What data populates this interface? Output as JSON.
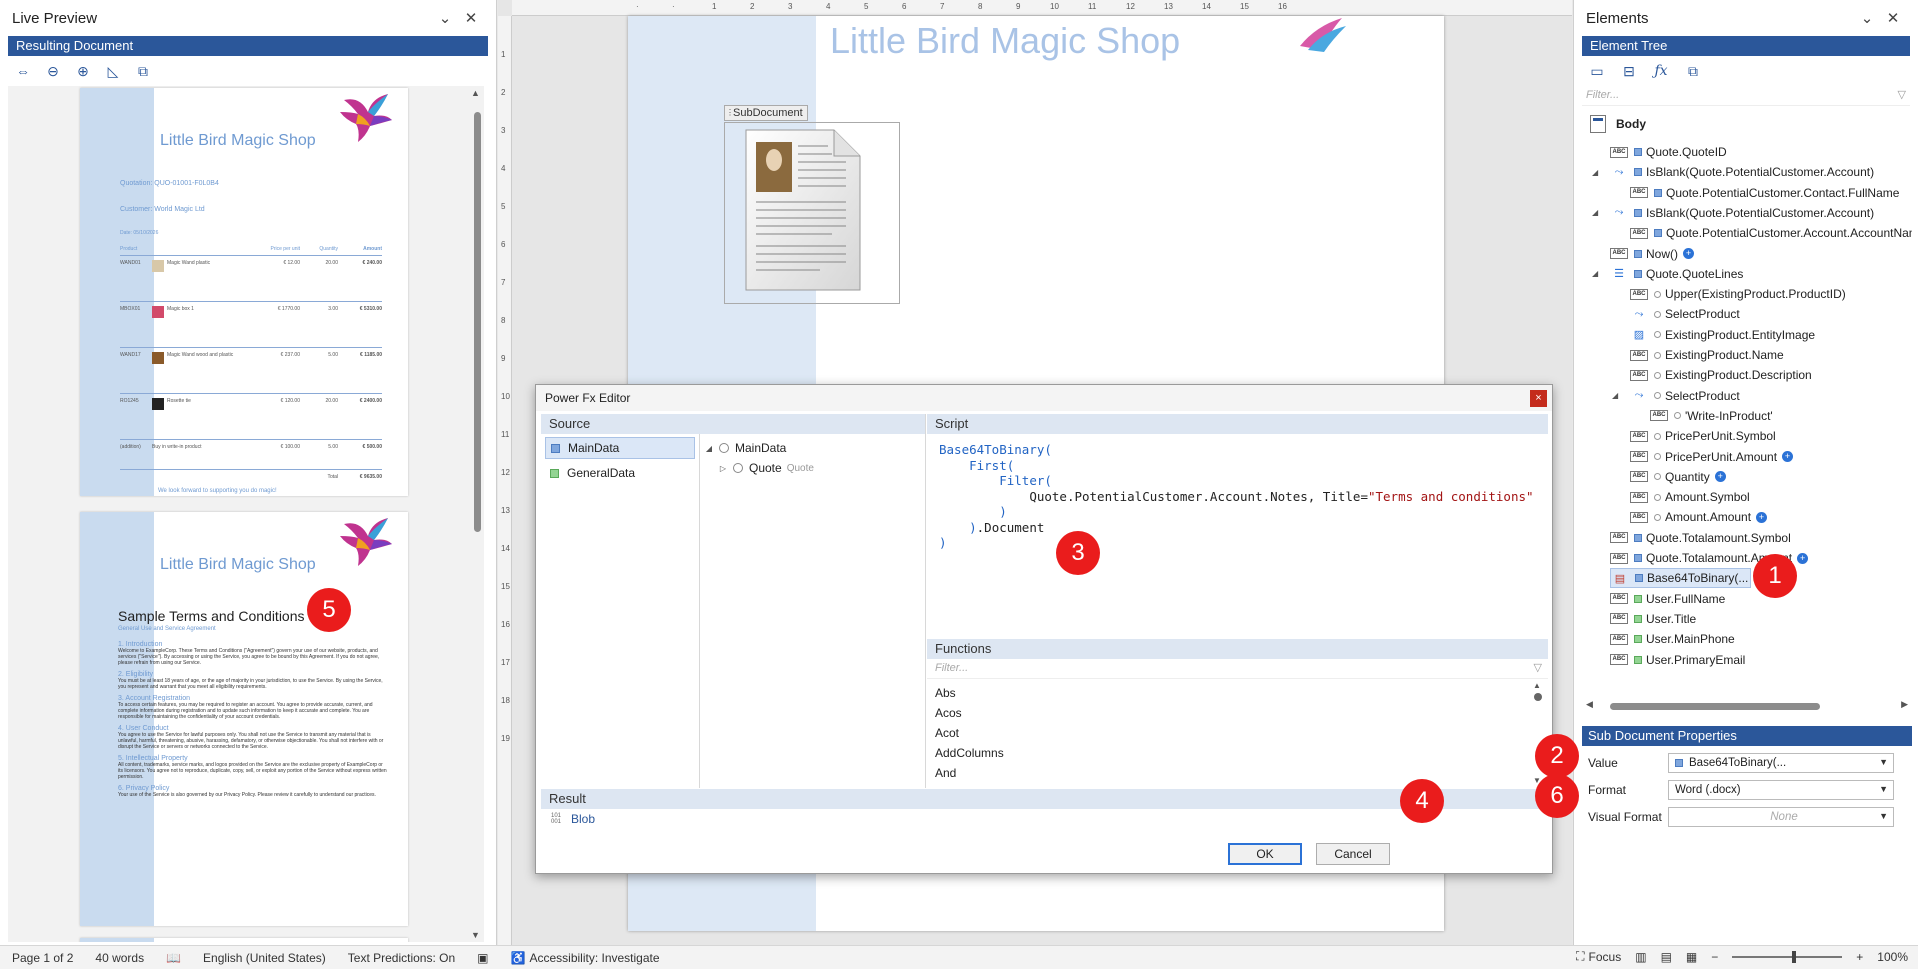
{
  "live_preview": {
    "title": "Live Preview",
    "bar": "Resulting Document",
    "page1": {
      "shop_title": "Little Bird Magic Shop",
      "quotation": "Quotation: QUO-01001-F0L0B4",
      "customer": "Customer: World Magic Ltd",
      "date": "Date: 05/10/2026",
      "table_head": [
        "Product",
        "",
        "Price per unit",
        "Quantity",
        "Amount"
      ],
      "rows": [
        [
          "WAND01",
          "Magic Wand plastic",
          "€ 12.00",
          "20.00",
          "€ 240.00"
        ],
        [
          "MBOX01",
          "Magic box 1",
          "€ 1770.00",
          "3.00",
          "€ 5310.00"
        ],
        [
          "WAND17",
          "Magic Wand wood and plastic",
          "€ 237.00",
          "5.00",
          "€ 1185.00"
        ],
        [
          "RO1245",
          "Rosette tie",
          "€ 120.00",
          "20.00",
          "€ 2400.00"
        ],
        [
          "(addition)",
          "Buy in write-in product",
          "€ 100.00",
          "5.00",
          "€ 500.00"
        ]
      ],
      "total_label": "Total",
      "total_value": "€ 9635.00",
      "footer": "We look forward to supporting you do magic!"
    },
    "page2": {
      "shop_title": "Little Bird Magic Shop",
      "terms_title": "Sample Terms and Conditions",
      "terms_subtitle": "General Use and Service Agreement",
      "sections": [
        {
          "h": "1. Introduction",
          "p": "Welcome to ExampleCorp. These Terms and Conditions (\"Agreement\") govern your use of our website, products, and services (\"Service\"). By accessing or using the Service, you agree to be bound by this Agreement. If you do not agree, please refrain from using our Service."
        },
        {
          "h": "2. Eligibility",
          "p": "You must be at least 18 years of age, or the age of majority in your jurisdiction, to use the Service. By using the Service, you represent and warrant that you meet all eligibility requirements."
        },
        {
          "h": "3. Account Registration",
          "p": "To access certain features, you may be required to register an account. You agree to provide accurate, current, and complete information during registration and to update such information to keep it accurate and complete. You are responsible for maintaining the confidentiality of your account credentials."
        },
        {
          "h": "4. User Conduct",
          "p": "You agree to use the Service for lawful purposes only. You shall not use the Service to transmit any material that is unlawful, harmful, threatening, abusive, harassing, defamatory, or otherwise objectionable. You shall not interfere with or disrupt the Service or servers or networks connected to the Service."
        },
        {
          "h": "5. Intellectual Property",
          "p": "All content, trademarks, service marks, and logos provided on the Service are the exclusive property of ExampleCorp or its licensors. You agree not to reproduce, duplicate, copy, sell, or exploit any portion of the Service without express written permission."
        },
        {
          "h": "6. Privacy Policy",
          "p": "Your use of the Service is also governed by our Privacy Policy. Please review it carefully to understand our practices."
        }
      ]
    }
  },
  "document": {
    "title": "Little Bird Magic Shop",
    "subdoc_label": "SubDocument"
  },
  "dialog": {
    "title": "Power Fx Editor",
    "close": "×",
    "source_head": "Source",
    "sources": [
      "MainData",
      "GeneralData"
    ],
    "tree": [
      {
        "label": "MainData",
        "muted": ""
      },
      {
        "label": "Quote",
        "muted": "Quote"
      }
    ],
    "script_head": "Script",
    "script": {
      "l1": "Base64ToBinary(",
      "l2": "First(",
      "l3": "Filter(",
      "l4_a": "Quote.PotentialCustomer.Account.Notes, Title=",
      "l4_b": "\"Terms and conditions\"",
      "l5": ")",
      "l6_a": ")",
      "l6_b": ".Document",
      "l7": ")"
    },
    "functions_head": "Functions",
    "functions_filter": "Filter...",
    "functions": [
      "Abs",
      "Acos",
      "Acot",
      "AddColumns",
      "And"
    ],
    "result_head": "Result",
    "result_bin": "101\n001",
    "result_value": "Blob",
    "ok": "OK",
    "cancel": "Cancel"
  },
  "elements": {
    "title": "Elements",
    "bar": "Element Tree",
    "filter": "Filter...",
    "body": "Body",
    "nodes": [
      "Quote.QuoteID",
      "IsBlank(Quote.PotentialCustomer.Account)",
      "Quote.PotentialCustomer.Contact.FullName",
      "IsBlank(Quote.PotentialCustomer.Account)",
      "Quote.PotentialCustomer.Account.AccountNam",
      "Now()",
      "Quote.QuoteLines",
      "Upper(ExistingProduct.ProductID)",
      "SelectProduct",
      "ExistingProduct.EntityImage",
      "ExistingProduct.Name",
      "ExistingProduct.Description",
      "SelectProduct",
      "'Write-InProduct'",
      "PricePerUnit.Symbol",
      "PricePerUnit.Amount",
      "Quantity",
      "Amount.Symbol",
      "Amount.Amount",
      "Quote.Totalamount.Symbol",
      "Quote.Totalamount.Amount",
      "Base64ToBinary(...",
      "User.FullName",
      "User.Title",
      "User.MainPhone",
      "User.PrimaryEmail"
    ],
    "props_head": "Sub Document Properties",
    "props": [
      {
        "label": "Value",
        "value": "Base64ToBinary(..."
      },
      {
        "label": "Format",
        "value": "Word (.docx)"
      },
      {
        "label": "Visual Format",
        "value": "None"
      }
    ]
  },
  "badges": [
    "1",
    "2",
    "3",
    "4",
    "5",
    "6"
  ],
  "status": {
    "page": "Page 1 of 2",
    "words": "40 words",
    "language": "English (United States)",
    "predictions": "Text Predictions: On",
    "accessibility": "Accessibility: Investigate",
    "focus": "Focus",
    "zoom": "100%"
  },
  "colors": {
    "accent": "#2b579a",
    "badge": "#ea1c1c",
    "close": "#c42b1c"
  }
}
